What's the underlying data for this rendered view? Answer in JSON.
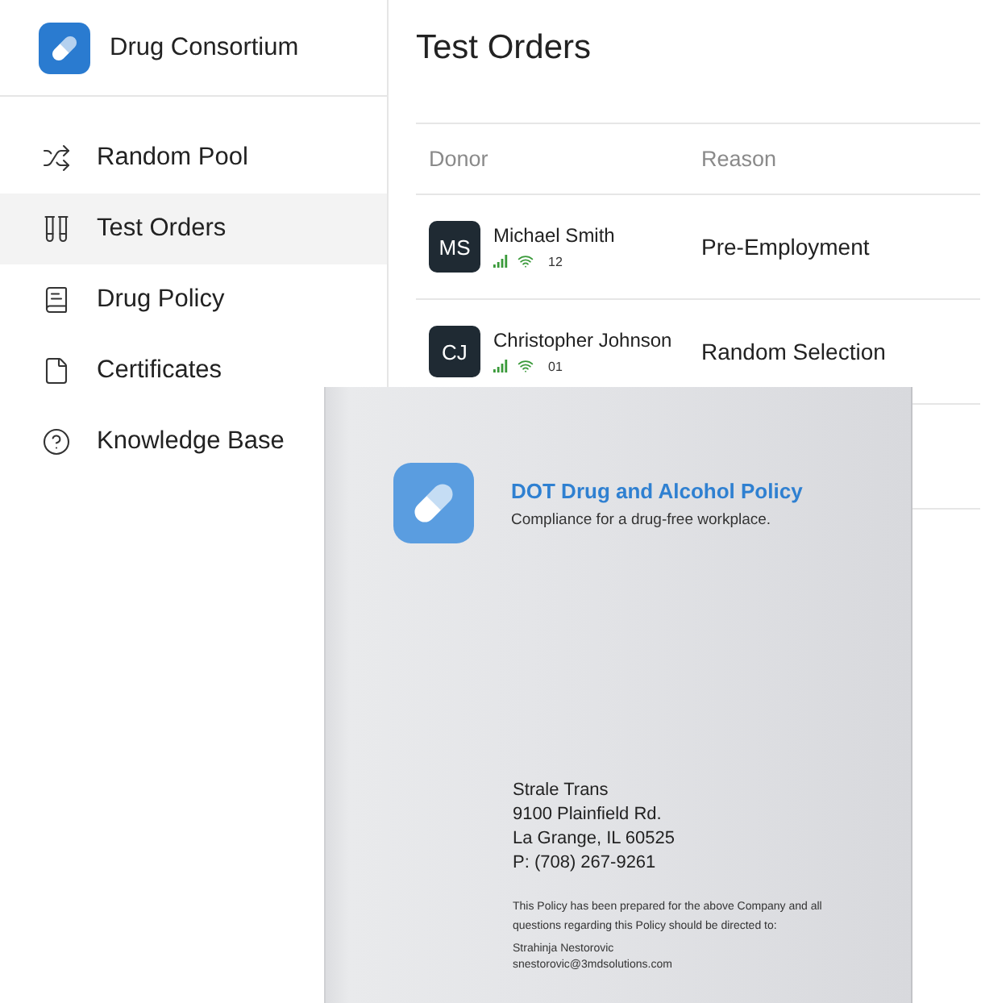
{
  "sidebar": {
    "brand": "Drug Consortium",
    "items": [
      {
        "label": "Random Pool",
        "selected": false
      },
      {
        "label": "Test Orders",
        "selected": true
      },
      {
        "label": "Drug Policy",
        "selected": false
      },
      {
        "label": "Certificates",
        "selected": false
      },
      {
        "label": "Knowledge Base",
        "selected": false
      }
    ]
  },
  "page": {
    "title": "Test Orders"
  },
  "table": {
    "columns": [
      "Donor",
      "Reason"
    ],
    "rows": [
      {
        "initials": "MS",
        "name": "Michael Smith",
        "count": "12",
        "reason": "Pre-Employment"
      },
      {
        "initials": "CJ",
        "name": "Christopher Johnson",
        "count": "01",
        "reason": "Random Selection"
      }
    ]
  },
  "document": {
    "title": "DOT Drug and Alcohol Policy",
    "subtitle": "Compliance for a drug-free workplace.",
    "address_lines": [
      "Strale Trans",
      "9100 Plainfield Rd.",
      "La Grange, IL 60525",
      "P: (708) 267-9261"
    ],
    "note": "This Policy has been prepared for the above Company and all questions regarding this Policy should be directed to:",
    "contact_name": "Strahinja Nestorovic",
    "contact_email": "snestorovic@3mdsolutions.com"
  }
}
